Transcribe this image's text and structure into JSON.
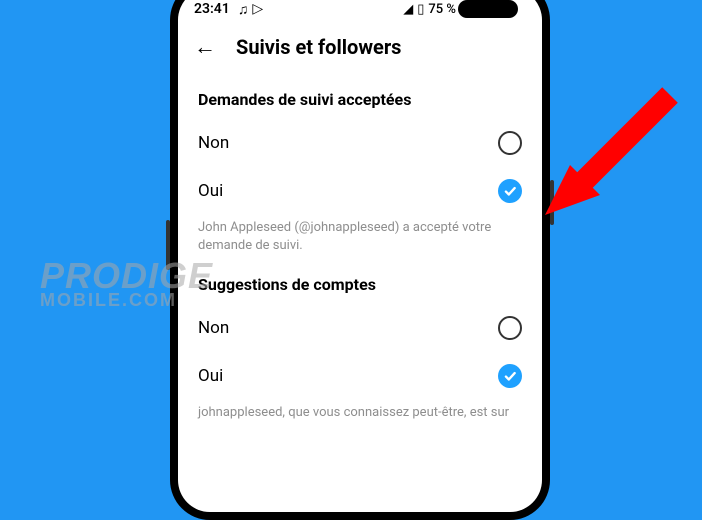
{
  "status_bar": {
    "time": "23:41",
    "battery": "75 %"
  },
  "header": {
    "title": "Suivis et followers"
  },
  "sections": {
    "follow_requests": {
      "title": "Demandes de suivi acceptées",
      "option_no": "Non",
      "option_yes": "Oui",
      "description": "John Appleseed (@johnappleseed) a accepté votre demande de suivi."
    },
    "account_suggestions": {
      "title": "Suggestions de comptes",
      "option_no": "Non",
      "option_yes": "Oui",
      "description": "johnappleseed, que vous connaissez peut-être, est sur"
    }
  },
  "watermark": {
    "line1": "PRODIGE",
    "line2": "MOBILE.COM"
  }
}
